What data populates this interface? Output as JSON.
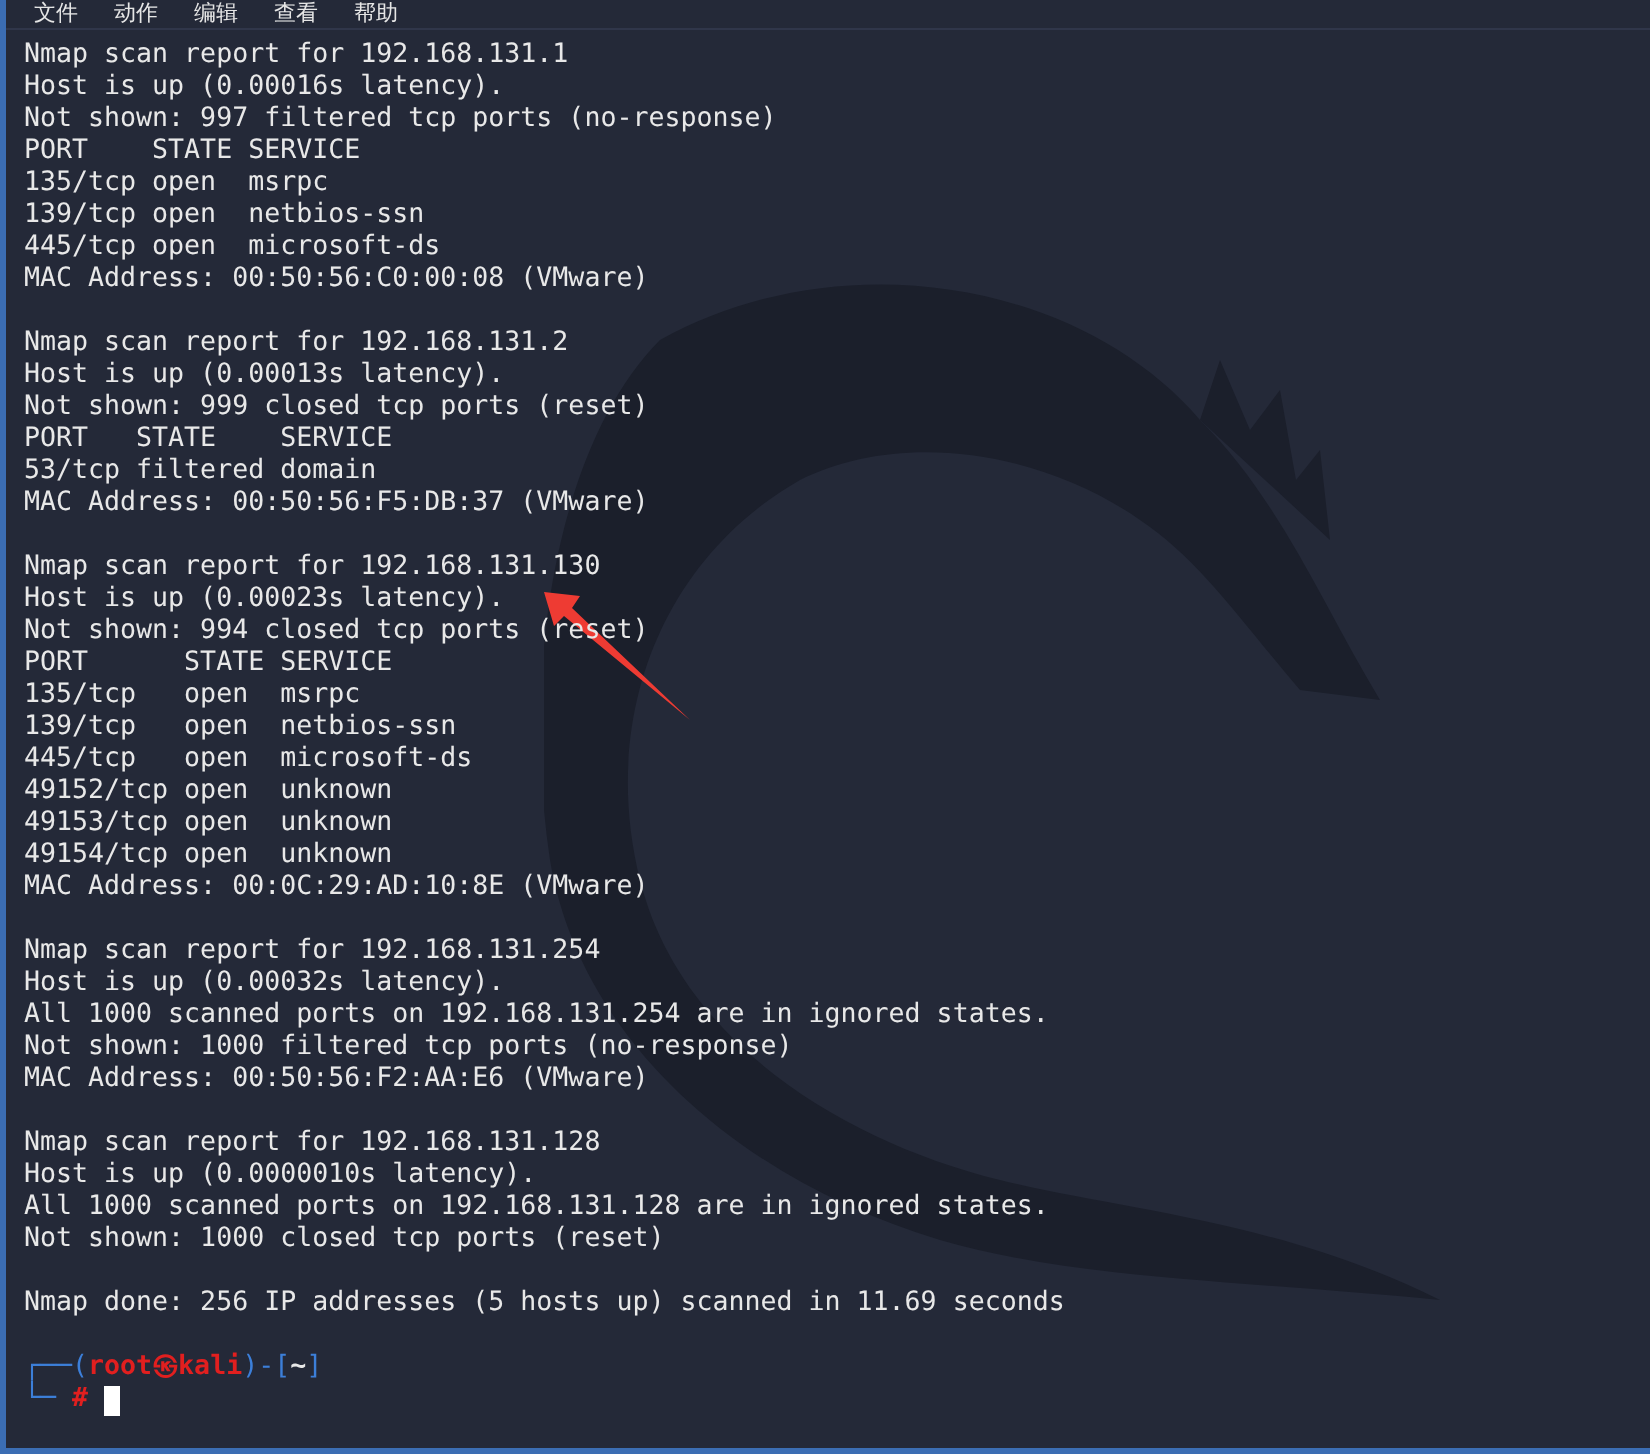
{
  "menu": [
    "文件",
    "动作",
    "编辑",
    "查看",
    "帮助"
  ],
  "reports": [
    {
      "lines": [
        "Nmap scan report for 192.168.131.1",
        "Host is up (0.00016s latency).",
        "Not shown: 997 filtered tcp ports (no-response)",
        "PORT    STATE SERVICE",
        "135/tcp open  msrpc",
        "139/tcp open  netbios-ssn",
        "445/tcp open  microsoft-ds",
        "MAC Address: 00:50:56:C0:00:08 (VMware)"
      ]
    },
    {
      "lines": [
        "Nmap scan report for 192.168.131.2",
        "Host is up (0.00013s latency).",
        "Not shown: 999 closed tcp ports (reset)",
        "PORT   STATE    SERVICE",
        "53/tcp filtered domain",
        "MAC Address: 00:50:56:F5:DB:37 (VMware)"
      ]
    },
    {
      "lines": [
        "Nmap scan report for 192.168.131.130",
        "Host is up (0.00023s latency).",
        "Not shown: 994 closed tcp ports (reset)",
        "PORT      STATE SERVICE",
        "135/tcp   open  msrpc",
        "139/tcp   open  netbios-ssn",
        "445/tcp   open  microsoft-ds",
        "49152/tcp open  unknown",
        "49153/tcp open  unknown",
        "49154/tcp open  unknown",
        "MAC Address: 00:0C:29:AD:10:8E (VMware)"
      ]
    },
    {
      "lines": [
        "Nmap scan report for 192.168.131.254",
        "Host is up (0.00032s latency).",
        "All 1000 scanned ports on 192.168.131.254 are in ignored states.",
        "Not shown: 1000 filtered tcp ports (no-response)",
        "MAC Address: 00:50:56:F2:AA:E6 (VMware)"
      ]
    },
    {
      "lines": [
        "Nmap scan report for 192.168.131.128",
        "Host is up (0.0000010s latency).",
        "All 1000 scanned ports on 192.168.131.128 are in ignored states.",
        "Not shown: 1000 closed tcp ports (reset)"
      ]
    },
    {
      "lines": [
        "Nmap done: 256 IP addresses (5 hosts up) scanned in 11.69 seconds"
      ]
    }
  ],
  "prompt": [
    [
      {
        "kind": "frame",
        "text": "┌──("
      },
      {
        "kind": "user",
        "text": "root㉿kali"
      },
      {
        "kind": "frame",
        "text": ")-["
      },
      {
        "kind": "path",
        "text": "~"
      },
      {
        "kind": "frame",
        "text": "]"
      }
    ],
    [
      {
        "kind": "frame",
        "text": "└─"
      },
      {
        "kind": "user",
        "text": "#"
      }
    ]
  ]
}
